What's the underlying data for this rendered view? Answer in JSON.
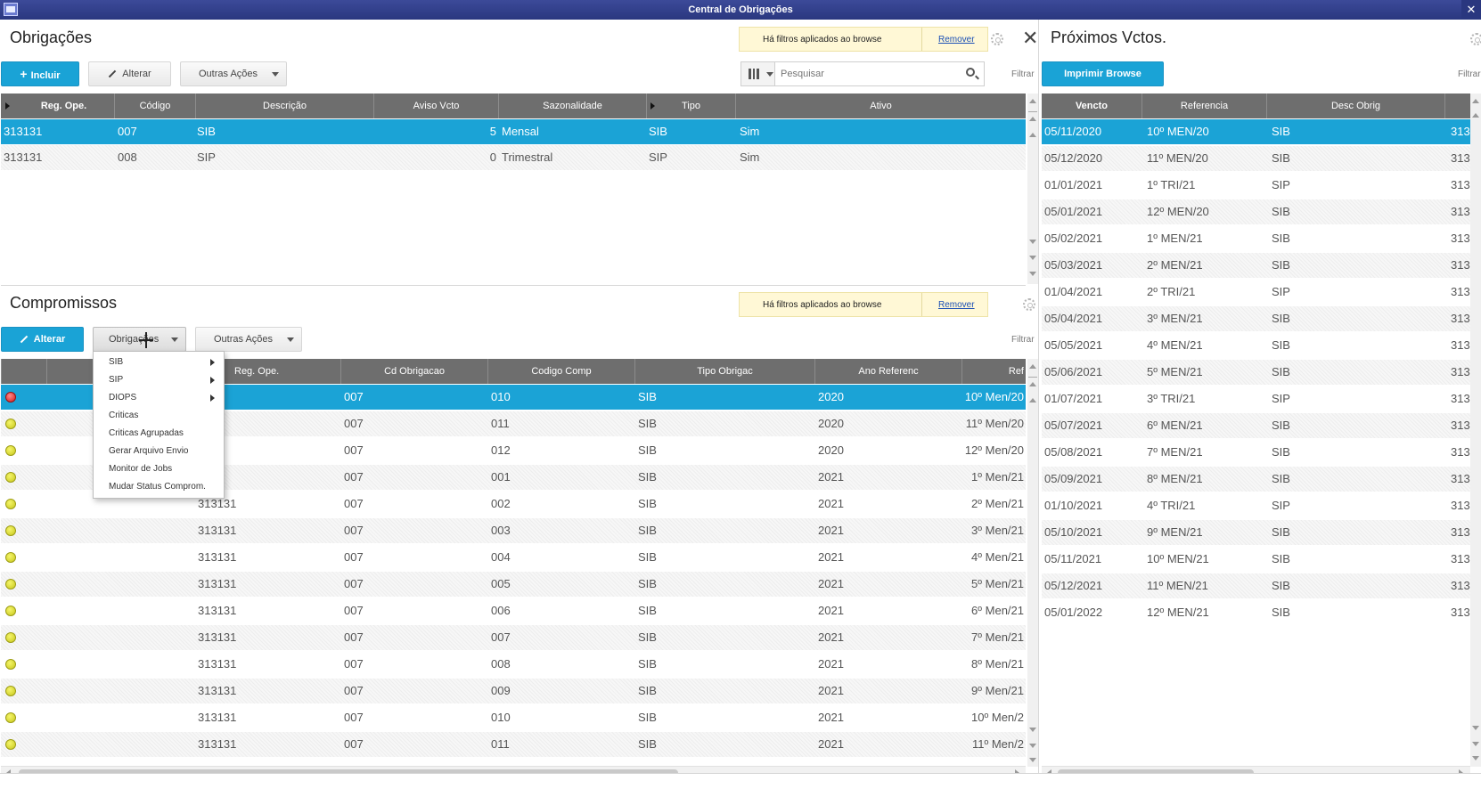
{
  "window": {
    "title": "Central de Obrigações"
  },
  "filter_banner": {
    "text": "Há filtros aplicados ao browse",
    "remove": "Remover"
  },
  "obrigacoes": {
    "title": "Obrigações",
    "buttons": {
      "incluir": "Incluir",
      "alterar": "Alterar",
      "outras_acoes": "Outras Ações"
    },
    "search_placeholder": "Pesquisar",
    "filtrar": "Filtrar",
    "columns": [
      "Reg. Ope.",
      "Código",
      "Descrição",
      "Aviso Vcto",
      "Sazonalidade",
      "Tipo",
      "Ativo"
    ],
    "rows": [
      {
        "reg": "313131",
        "codigo": "007",
        "descricao": "SIB",
        "aviso": "5",
        "sazonalidade": "Mensal",
        "tipo": "SIB",
        "ativo": "Sim"
      },
      {
        "reg": "313131",
        "codigo": "008",
        "descricao": "SIP",
        "aviso": "0",
        "sazonalidade": "Trimestral",
        "tipo": "SIP",
        "ativo": "Sim"
      }
    ]
  },
  "proximos": {
    "title": "Próximos Vctos.",
    "print_button": "Imprimir Browse",
    "filtrar": "Filtrar",
    "columns": [
      "Vencto",
      "Referencia",
      "Desc Obrig"
    ],
    "rows": [
      {
        "vencto": "05/11/2020",
        "ref": "10º MEN/20",
        "desc": "SIB",
        "extra": "313"
      },
      {
        "vencto": "05/12/2020",
        "ref": "11º MEN/20",
        "desc": "SIB",
        "extra": "313"
      },
      {
        "vencto": "01/01/2021",
        "ref": "1º TRI/21",
        "desc": "SIP",
        "extra": "313"
      },
      {
        "vencto": "05/01/2021",
        "ref": "12º MEN/20",
        "desc": "SIB",
        "extra": "313"
      },
      {
        "vencto": "05/02/2021",
        "ref": "1º MEN/21",
        "desc": "SIB",
        "extra": "313"
      },
      {
        "vencto": "05/03/2021",
        "ref": "2º MEN/21",
        "desc": "SIB",
        "extra": "313"
      },
      {
        "vencto": "01/04/2021",
        "ref": "2º TRI/21",
        "desc": "SIP",
        "extra": "313"
      },
      {
        "vencto": "05/04/2021",
        "ref": "3º MEN/21",
        "desc": "SIB",
        "extra": "313"
      },
      {
        "vencto": "05/05/2021",
        "ref": "4º MEN/21",
        "desc": "SIB",
        "extra": "313"
      },
      {
        "vencto": "05/06/2021",
        "ref": "5º MEN/21",
        "desc": "SIB",
        "extra": "313"
      },
      {
        "vencto": "01/07/2021",
        "ref": "3º TRI/21",
        "desc": "SIP",
        "extra": "313"
      },
      {
        "vencto": "05/07/2021",
        "ref": "6º MEN/21",
        "desc": "SIB",
        "extra": "313"
      },
      {
        "vencto": "05/08/2021",
        "ref": "7º MEN/21",
        "desc": "SIB",
        "extra": "313"
      },
      {
        "vencto": "05/09/2021",
        "ref": "8º MEN/21",
        "desc": "SIB",
        "extra": "313"
      },
      {
        "vencto": "01/10/2021",
        "ref": "4º TRI/21",
        "desc": "SIP",
        "extra": "313"
      },
      {
        "vencto": "05/10/2021",
        "ref": "9º MEN/21",
        "desc": "SIB",
        "extra": "313"
      },
      {
        "vencto": "05/11/2021",
        "ref": "10º MEN/21",
        "desc": "SIB",
        "extra": "313"
      },
      {
        "vencto": "05/12/2021",
        "ref": "11º MEN/21",
        "desc": "SIB",
        "extra": "313"
      },
      {
        "vencto": "05/01/2022",
        "ref": "12º MEN/21",
        "desc": "SIB",
        "extra": "313"
      }
    ]
  },
  "compromissos": {
    "title": "Compromissos",
    "buttons": {
      "alterar": "Alterar",
      "obrigacoes": "Obrigações",
      "outras_acoes": "Outras Ações"
    },
    "filtrar": "Filtrar",
    "columns": [
      "Reg. Ope.",
      "Cd Obrigacao",
      "Codigo Comp",
      "Tipo Obrigac",
      "Ano Referenc",
      "Ref"
    ],
    "menu": [
      {
        "label": "SIB",
        "submenu": true
      },
      {
        "label": "SIP",
        "submenu": true
      },
      {
        "label": "DIOPS",
        "submenu": true
      },
      {
        "label": "Criticas",
        "submenu": false
      },
      {
        "label": "Criticas Agrupadas",
        "submenu": false
      },
      {
        "label": "Gerar Arquivo Envio",
        "submenu": false
      },
      {
        "label": "Monitor de Jobs",
        "submenu": false
      },
      {
        "label": "Mudar Status Comprom.",
        "submenu": false
      }
    ],
    "rows": [
      {
        "status": "red",
        "reg": "31",
        "cd": "007",
        "comp": "010",
        "tipo": "SIB",
        "ano": "2020",
        "ref": "10º Men/20"
      },
      {
        "status": "yellow",
        "reg": "31",
        "cd": "007",
        "comp": "011",
        "tipo": "SIB",
        "ano": "2020",
        "ref": "11º Men/20"
      },
      {
        "status": "yellow",
        "reg": "31",
        "cd": "007",
        "comp": "012",
        "tipo": "SIB",
        "ano": "2020",
        "ref": "12º Men/20"
      },
      {
        "status": "yellow",
        "reg": "31",
        "cd": "007",
        "comp": "001",
        "tipo": "SIB",
        "ano": "2021",
        "ref": "1º Men/21"
      },
      {
        "status": "yellow",
        "reg": "313131",
        "cd": "007",
        "comp": "002",
        "tipo": "SIB",
        "ano": "2021",
        "ref": "2º Men/21"
      },
      {
        "status": "yellow",
        "reg": "313131",
        "cd": "007",
        "comp": "003",
        "tipo": "SIB",
        "ano": "2021",
        "ref": "3º Men/21"
      },
      {
        "status": "yellow",
        "reg": "313131",
        "cd": "007",
        "comp": "004",
        "tipo": "SIB",
        "ano": "2021",
        "ref": "4º Men/21"
      },
      {
        "status": "yellow",
        "reg": "313131",
        "cd": "007",
        "comp": "005",
        "tipo": "SIB",
        "ano": "2021",
        "ref": "5º Men/21"
      },
      {
        "status": "yellow",
        "reg": "313131",
        "cd": "007",
        "comp": "006",
        "tipo": "SIB",
        "ano": "2021",
        "ref": "6º Men/21"
      },
      {
        "status": "yellow",
        "reg": "313131",
        "cd": "007",
        "comp": "007",
        "tipo": "SIB",
        "ano": "2021",
        "ref": "7º Men/21"
      },
      {
        "status": "yellow",
        "reg": "313131",
        "cd": "007",
        "comp": "008",
        "tipo": "SIB",
        "ano": "2021",
        "ref": "8º Men/21"
      },
      {
        "status": "yellow",
        "reg": "313131",
        "cd": "007",
        "comp": "009",
        "tipo": "SIB",
        "ano": "2021",
        "ref": "9º Men/21"
      },
      {
        "status": "yellow",
        "reg": "313131",
        "cd": "007",
        "comp": "010",
        "tipo": "SIB",
        "ano": "2021",
        "ref": "10º Men/2"
      },
      {
        "status": "yellow",
        "reg": "313131",
        "cd": "007",
        "comp": "011",
        "tipo": "SIB",
        "ano": "2021",
        "ref": "11º Men/2"
      }
    ]
  },
  "colors": {
    "accent": "#1ba3d6",
    "header": "#6e6e6e",
    "titlebar": "#2a377f",
    "banner": "#fff8d6"
  }
}
